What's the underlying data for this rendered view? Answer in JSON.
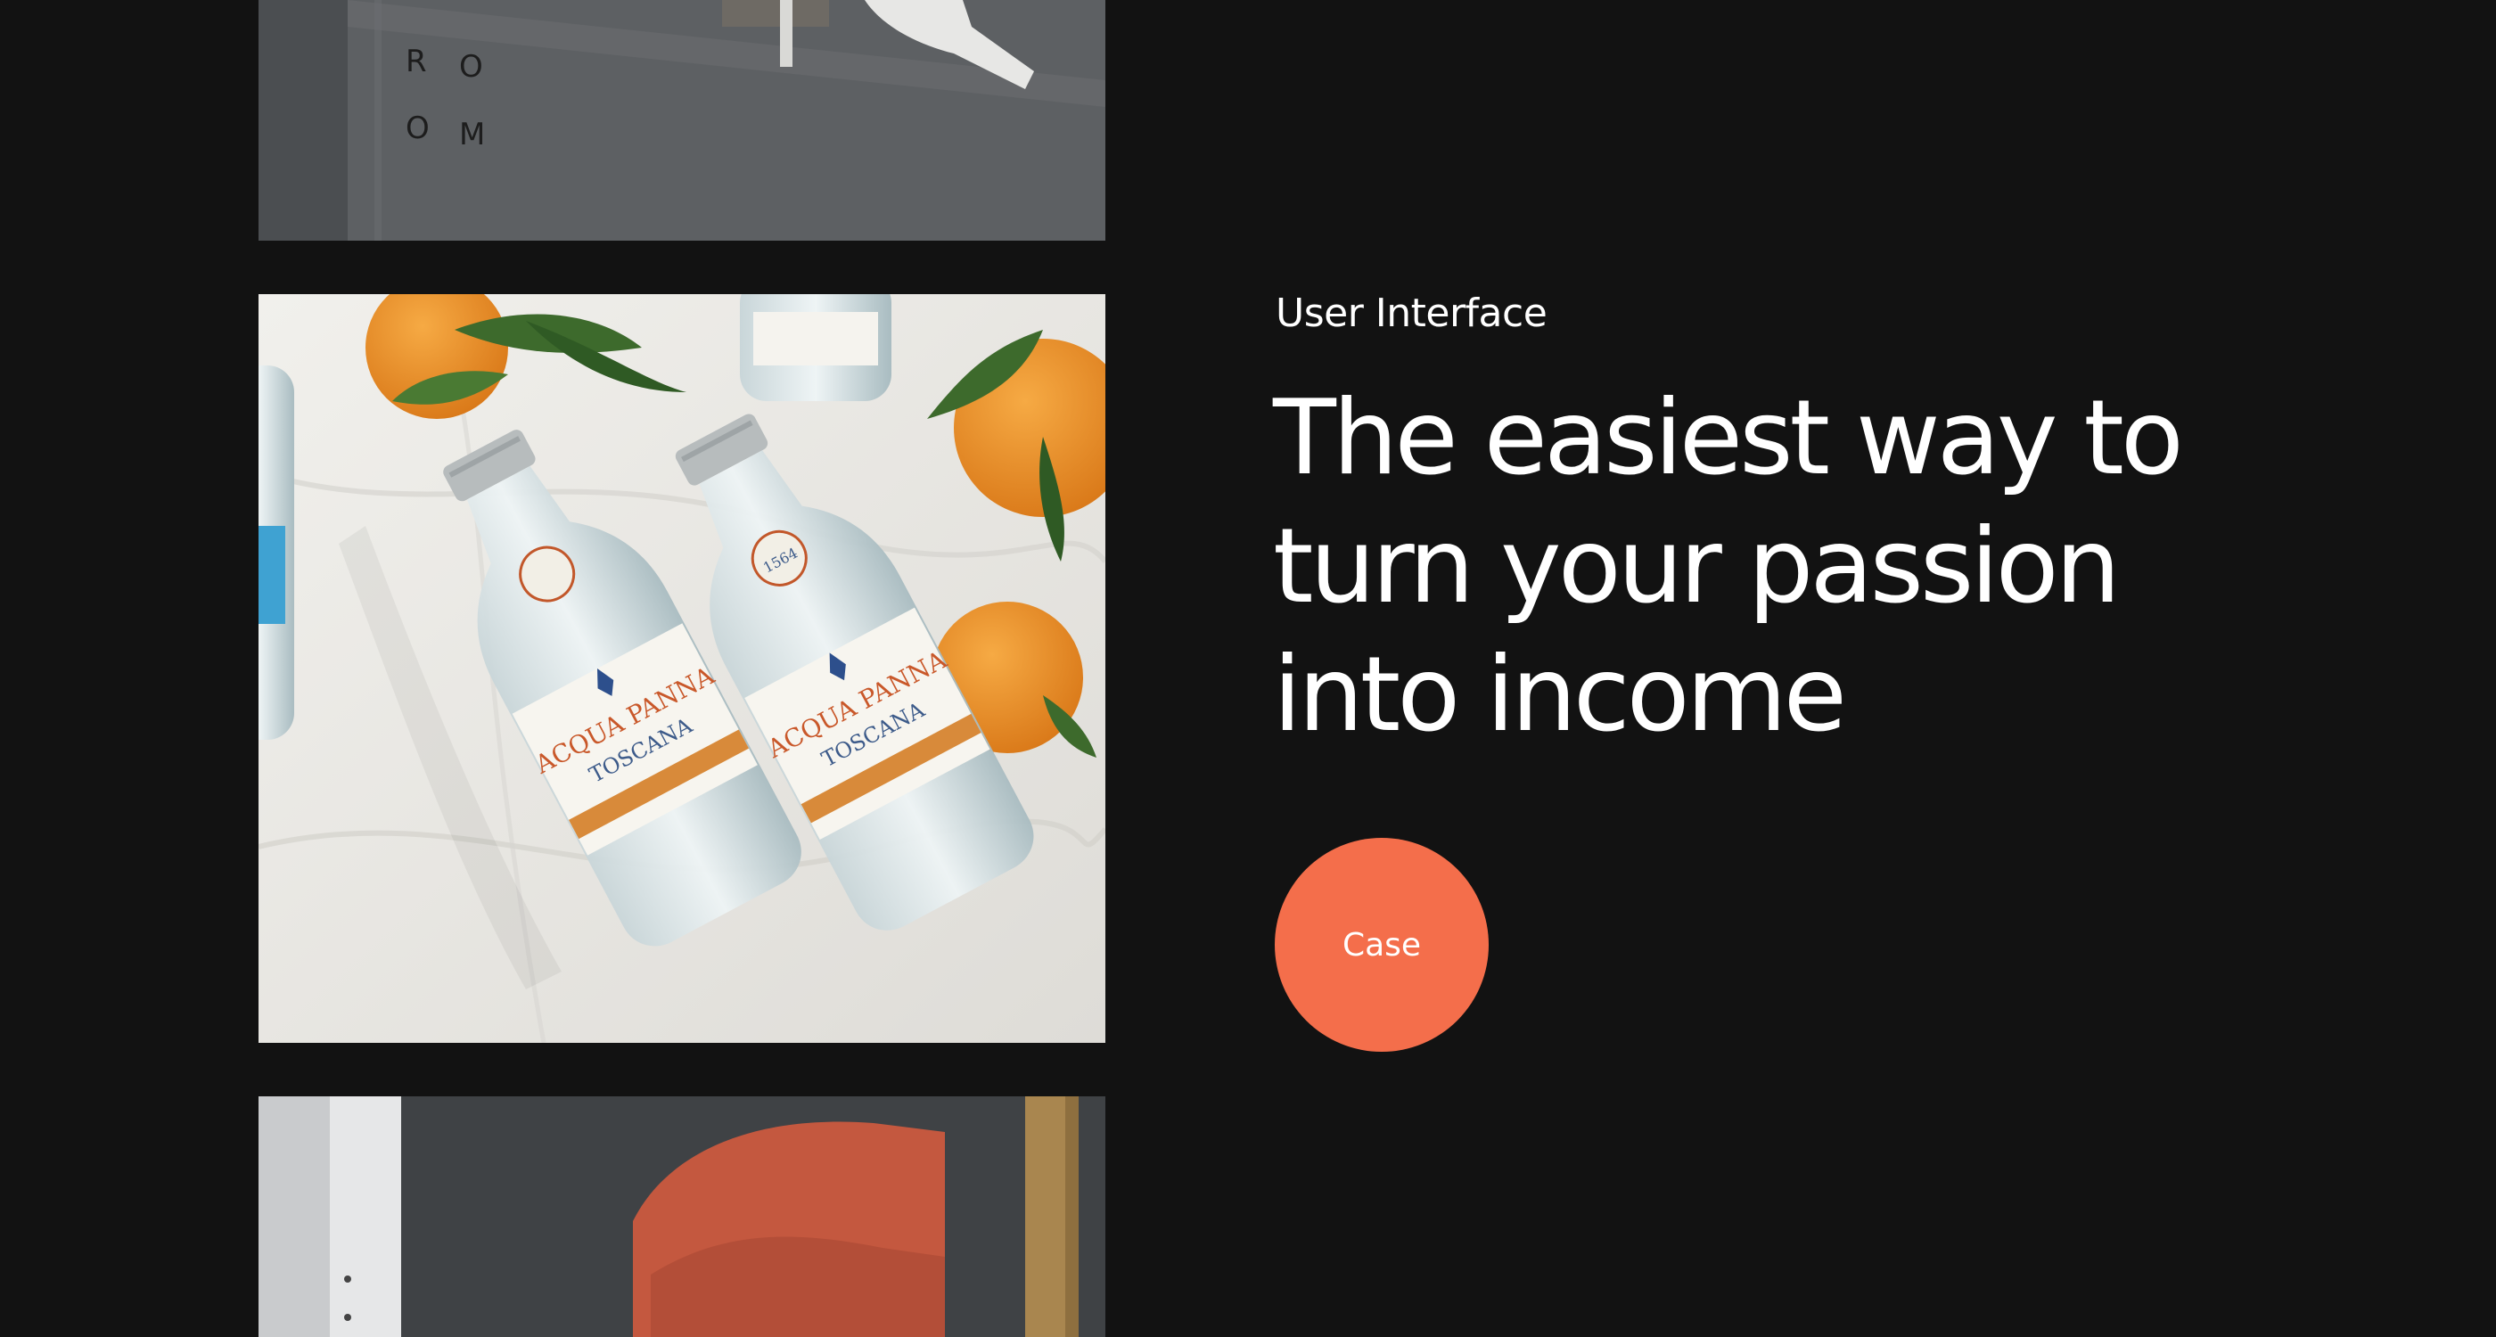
{
  "project": {
    "category": "User Interface",
    "headline_lines": [
      "The easiest way to",
      "turn your passion",
      "into income"
    ],
    "cta_label": "Case"
  },
  "images": {
    "top": {
      "label": "previous project image",
      "sign_letters": [
        "R",
        "O",
        "O",
        "M"
      ]
    },
    "main": {
      "label": "featured project image",
      "bottle_brand": "ACQUA PANNA",
      "bottle_sub": "TOSCANA",
      "bottle_year": "1564"
    },
    "bottom": {
      "label": "next project image"
    }
  },
  "colors": {
    "background": "#121212",
    "accent": "#f46e4b",
    "text": "#ffffff"
  }
}
